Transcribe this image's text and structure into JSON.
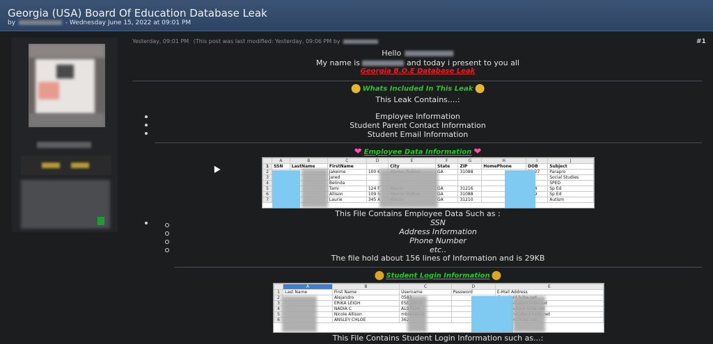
{
  "thread": {
    "title": "Georgia (USA) Board Of Education Database Leak",
    "by_prefix": "by",
    "date": "- Wednesday June 15, 2022 at 09:01 PM"
  },
  "post": {
    "time": "Yesterday, 09:01 PM",
    "modified": "(This post was last modified: Yesterday, 09:06 PM by",
    "number": "#1",
    "hello": "Hello",
    "intro_a": "My name is",
    "intro_b": "and today i present to you all",
    "leak_title": "Georgia B.O.E Database Leak",
    "included_heading": "Whats Included In This Leak",
    "contains_intro": "This Leak Contains....:",
    "contains_items": [
      "Employee Information",
      "Student Parent Contact Information",
      "Student Email Information"
    ],
    "employee_heading": "Employee Data Information",
    "employee_desc": "This File Contains Employee Data Such as :",
    "employee_fields": [
      "SSN",
      "Address Information",
      "Phone Number",
      "etc.."
    ],
    "employee_size": "The file hold about 156 lines of Information and is 29KB",
    "student_heading": "Student Login Information",
    "student_desc": "This File Contains Student Login Information such as...:"
  },
  "employee_sheet": {
    "col_letters": [
      "",
      "A",
      "B",
      "C",
      "D",
      "E",
      "F",
      "G",
      "H",
      "I",
      "J"
    ],
    "headers": [
      "1",
      "SSN",
      "LastName",
      "FirstName",
      "",
      "City",
      "State",
      "ZIP",
      "HomePhone",
      "DOB",
      "Subject"
    ],
    "rows": [
      [
        "2",
        "",
        "",
        "Jakeime",
        "100 K",
        "Warner Robins",
        "GA",
        "31088",
        "",
        "12/27",
        "Parapro"
      ],
      [
        "3",
        "",
        "",
        "Jared",
        "",
        "",
        "",
        "",
        "",
        "",
        "Social Studies"
      ],
      [
        "4",
        "",
        "",
        "Belinda",
        "",
        "",
        "",
        "",
        "",
        "",
        "SPED"
      ],
      [
        "5",
        "",
        "",
        "Tami",
        "124 F",
        "Macon",
        "GA",
        "31216",
        "",
        "3/14",
        "Sp Ed"
      ],
      [
        "6",
        "",
        "",
        "Allison",
        "109 S",
        "Warner Robins",
        "GA",
        "31088",
        "",
        "7/29",
        "Sp Ed"
      ],
      [
        "7",
        "",
        "",
        "Laurie",
        "345 A",
        "Macon",
        "GA",
        "31210",
        "",
        "9/8",
        "Autism"
      ]
    ]
  },
  "student_sheet": {
    "col_letters": [
      "",
      "A",
      "B",
      "C",
      "D",
      "E"
    ],
    "headers": [
      "1",
      "Last Name",
      "First Name",
      "Username",
      "Password",
      "E-Mail Address"
    ],
    "rows": [
      [
        "2",
        "",
        "Alejandro",
        "0583",
        "",
        "@student.hcbe.net"
      ],
      [
        "3",
        "",
        "ERIKA LEIGH",
        "ESE22835",
        "",
        "2835@student.hcbe.net"
      ],
      [
        "4",
        "",
        "NADIA C",
        "AL97649",
        "",
        "649@student.hcbe.net"
      ],
      [
        "5",
        "",
        "Nicole Allison",
        "mbie44122",
        "",
        "44122@student.hcbe.net"
      ],
      [
        "6",
        "",
        "ANSLEY CHLOE",
        "362",
        "",
        "@student.hcbe.net"
      ]
    ]
  },
  "colors": {
    "header_bg": "#2d4464",
    "page_bg": "#1c1d1f",
    "accent_red": "#e0202a",
    "accent_green": "#2ec42e"
  }
}
